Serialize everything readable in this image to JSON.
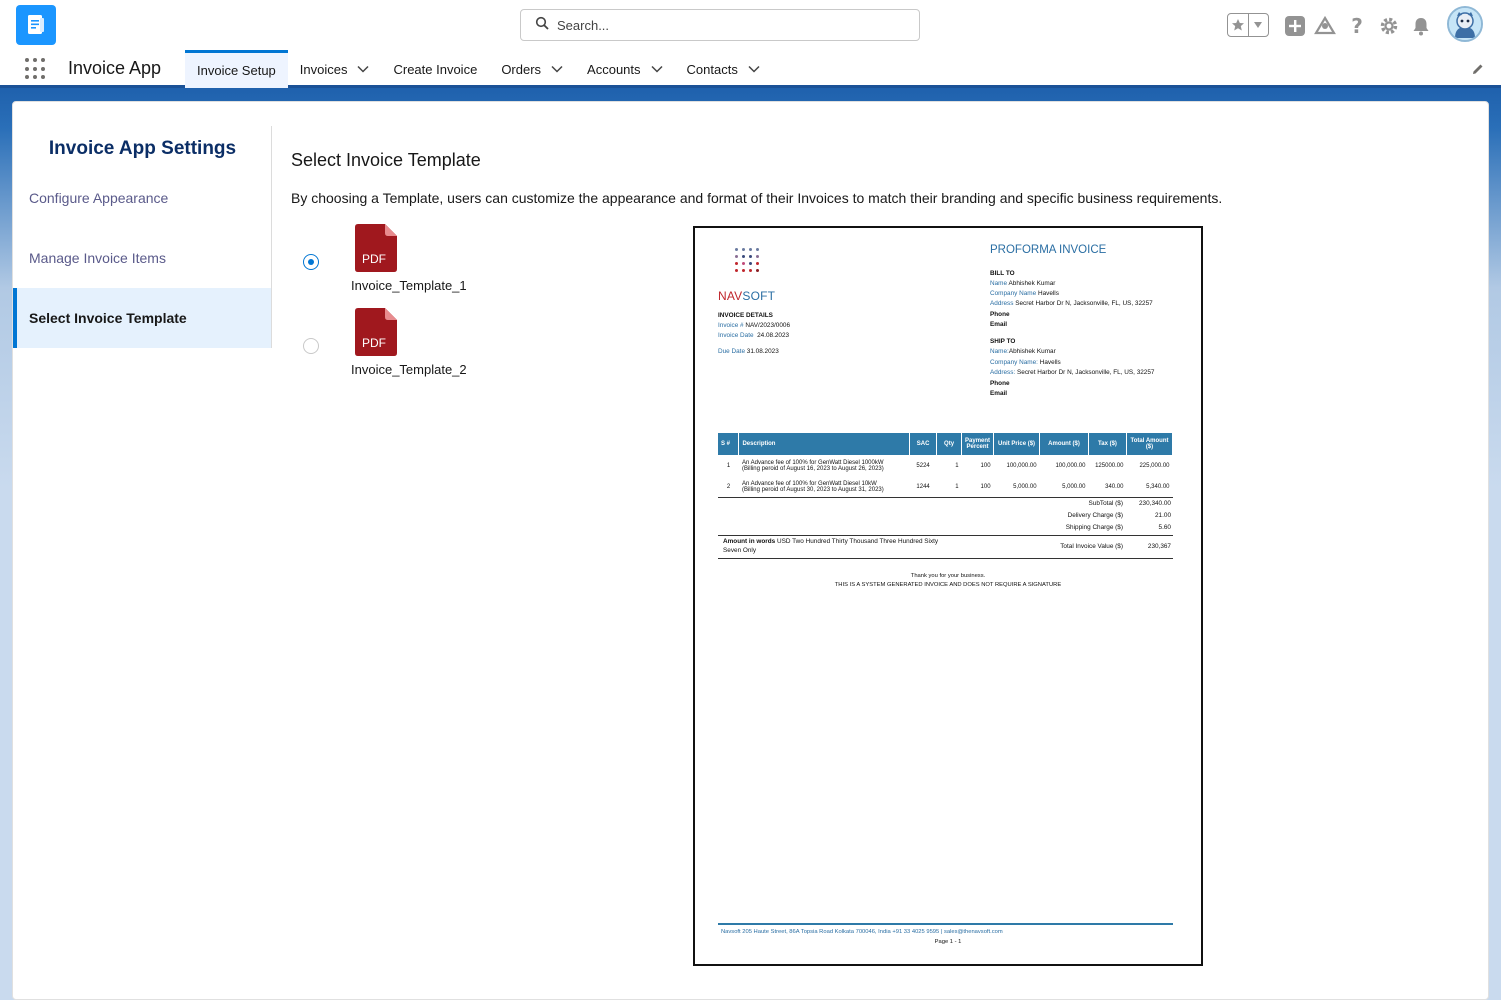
{
  "header": {
    "search_placeholder": "Search...",
    "icons": [
      "app-icon",
      "search-icon",
      "star-icon",
      "chevron-down-icon",
      "plus-icon",
      "trailhead-icon",
      "help-icon",
      "gear-icon",
      "bell-icon",
      "avatar"
    ]
  },
  "nav": {
    "app_name": "Invoice App",
    "items": [
      {
        "label": "Invoice Setup",
        "active": true,
        "has_menu": false
      },
      {
        "label": "Invoices",
        "active": false,
        "has_menu": true
      },
      {
        "label": "Create Invoice",
        "active": false,
        "has_menu": false
      },
      {
        "label": "Orders",
        "active": false,
        "has_menu": true
      },
      {
        "label": "Accounts",
        "active": false,
        "has_menu": true
      },
      {
        "label": "Contacts",
        "active": false,
        "has_menu": true
      }
    ]
  },
  "sidebar": {
    "title": "Invoice App Settings",
    "items": [
      {
        "label": "Configure Appearance",
        "active": false
      },
      {
        "label": "Manage Invoice Items",
        "active": false
      },
      {
        "label": "Select Invoice Template",
        "active": true
      }
    ]
  },
  "main": {
    "title": "Select Invoice Template",
    "description": "By choosing a Template, users can customize the appearance and format of their Invoices to match their branding and specific business requirements.",
    "templates": [
      {
        "name": "Invoice_Template_1",
        "icon_text": "PDF",
        "selected": true
      },
      {
        "name": "Invoice_Template_2",
        "icon_text": "PDF",
        "selected": false
      }
    ]
  },
  "preview": {
    "company_nav": "NAV",
    "company_soft": "SOFT",
    "doc_title": "PROFORMA INVOICE",
    "invoice_details_heading": "INVOICE DETAILS",
    "invoice_no_label": "Invoice #",
    "invoice_no": "NAV/2023/0006",
    "invoice_date_label": "Invoice Date",
    "invoice_date": "24.08.2023",
    "due_date_label": "Due Date",
    "due_date": "31.08.2023",
    "bill_to": {
      "heading": "BILL TO",
      "name_label": "Name",
      "name": "Abhishek Kumar",
      "company_label": "Company Name",
      "company": "Havells",
      "address_label": "Address",
      "address": "Secret Harbor Dr N, Jacksonville, FL, US, 32257",
      "phone_label": "Phone",
      "email_label": "Email"
    },
    "ship_to": {
      "heading": "SHIP TO",
      "name_label": "Name:",
      "name": "Abhishek Kumar",
      "company_label": "Company Name:",
      "company": "Havells",
      "address_label": "Address:",
      "address": "Secret Harbor Dr N, Jacksonville, FL, US, 32257",
      "phone_label": "Phone",
      "email_label": "Email"
    },
    "table_headers": [
      "S #",
      "Description",
      "SAC",
      "Qty",
      "Payment Percent",
      "Unit Price ($)",
      "Amount ($)",
      "Tax ($)",
      "Total Amount ($)"
    ],
    "rows": [
      {
        "sn": "1",
        "desc1": "An Advance fee of 100% for GenWatt Diesel 1000kW",
        "desc2": "(Billing peroid of August 16, 2023 to August 26, 2023)",
        "sac": "5224",
        "qty": "1",
        "pct": "100",
        "unit": "100,000.00",
        "amount": "100,000.00",
        "tax": "125000.00",
        "total": "225,000.00"
      },
      {
        "sn": "2",
        "desc1": "An Advance fee of 100% for GenWatt Diesel 10kW",
        "desc2": "(Billing peroid of August 30, 2023 to August 31, 2023)",
        "sac": "1244",
        "qty": "1",
        "pct": "100",
        "unit": "5,000.00",
        "amount": "5,000.00",
        "tax": "340.00",
        "total": "5,340.00"
      }
    ],
    "subtotal_label": "SubTotal ($)",
    "subtotal": "230,340.00",
    "delivery_label": "Delivery Charge ($)",
    "delivery": "21.00",
    "shipping_label": "Shipping Charge ($)",
    "shipping": "5.60",
    "words_label": "Amount in words",
    "words_line1": "USD Two Hundred Thirty Thousand Three Hundred Sixty",
    "words_line2": "Seven Only",
    "total_value_label": "Total Invoice Value ($)",
    "total_value": "230,367",
    "thanks": "Thank you for your business.",
    "system_note": "THIS IS A SYSTEM GENERATED INVOICE AND DOES NOT REQUIRE A SIGNATURE",
    "footer_address": "Navsoft 205 Haute Street, 86A Topsia Road Kolkata 700046, India +91 33 4025 9595 | sales@thenavsoft.com",
    "page_no": "Page 1 - 1"
  },
  "colors": {
    "brand_blue": "#0176d3",
    "nav_underline": "#1b5297",
    "pdf_red": "#a0181e",
    "invoice_blue": "#2a6ea3",
    "table_header": "#2e7aa8",
    "logo_red": "#c0272d"
  }
}
